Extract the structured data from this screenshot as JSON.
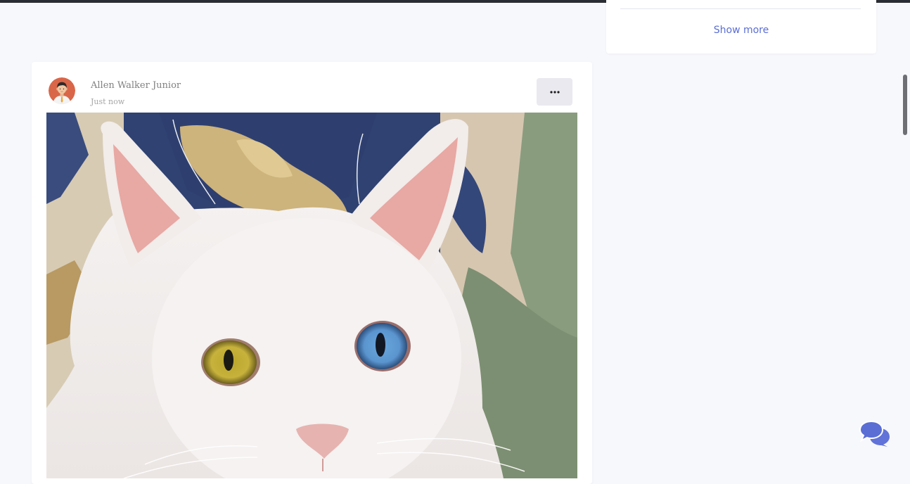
{
  "sidebar_widget": {
    "show_more_label": "Show more"
  },
  "post": {
    "author_name": "Allen Walker Junior",
    "timestamp": "Just now",
    "avatar_icon": "user-avatar-icon",
    "more_icon": "ellipsis-icon",
    "image_subject": "white-cat-heterochromia-photo"
  },
  "chat": {
    "icon": "chat-bubbles-icon"
  },
  "colors": {
    "page_bg": "#f7f8fc",
    "card_bg": "#ffffff",
    "accent": "#5a6ed4",
    "muted_text": "#808080",
    "button_bg": "#e9e9ef"
  }
}
